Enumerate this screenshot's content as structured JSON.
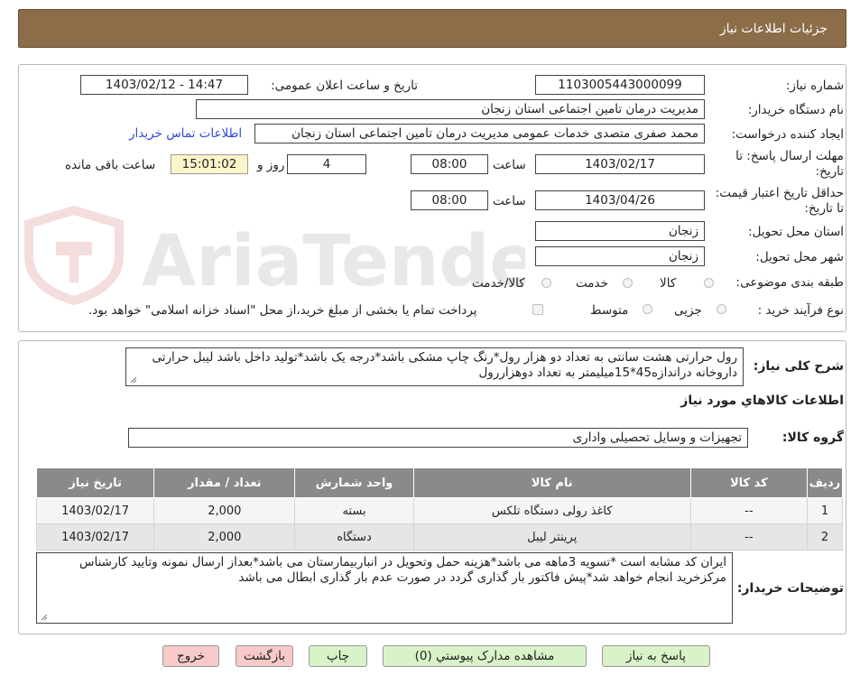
{
  "header": {
    "title": "جزئیات اطلاعات نیاز"
  },
  "labels": {
    "need_number": "شماره نیاز:",
    "announce_datetime": "تاریخ و ساعت اعلان عمومی:",
    "buyer_org": "نام دستگاه خریدار:",
    "requester": "ایجاد کننده درخواست:",
    "reply_deadline": "مهلت ارسال پاسخ: تا تاریخ:",
    "time": "ساعت",
    "day_and": "روز و",
    "remaining": "ساعت باقی مانده",
    "price_validity": "حداقل تاریخ اعتبار قیمت: تا تاریخ:",
    "delivery_province": "استان محل تحویل:",
    "delivery_city": "شهر محل تحویل:",
    "category": "طبقه بندی موضوعی:",
    "process_type": "نوع فرآیند خرید :",
    "general_desc": "شرح کلی نیاز:",
    "items_info": "اطلاعات کالاهاي مورد نياز",
    "goods_group": "گروه کالا:",
    "buyer_notes": "توضیحات خریدار:"
  },
  "values": {
    "need_number": "1103005443000099",
    "announce_datetime": "1403/02/12 - 14:47",
    "buyer_org": "مدیریت درمان تامین اجتماعی استان زنجان",
    "requester": "محمد صفری متصدی خدمات عمومی مدیریت درمان تامین اجتماعی استان زنجان",
    "contact_link": "اطلاعات تماس خریدار",
    "reply_date": "1403/02/17",
    "reply_time": "08:00",
    "days": "4",
    "remaining_time": "15:01:02",
    "validity_date": "1403/04/26",
    "validity_time": "08:00",
    "province": "زنجان",
    "city": "زنجان",
    "goods_group": "تجهیزات و وسایل تحصیلی واداری",
    "general_desc": "رول حرارتی هشت سانتی به تعداد دو هزار رول*رنگ چاپ مشکی باشد*درجه یک باشد*تولید داخل باشد لیبل حرارتی داروخانه دراندازه45*15میلیمتر به تعداد دوهزاررول",
    "buyer_notes": "ایران کد مشابه است *تسویه 3ماهه می باشد*هزینه حمل وتحویل در انباربیمارستان می باشد*بعداز ارسال نمونه وتایید کارشناس مرکزخرید انجام خواهد شد*پیش فاکتور بار گذاری گردد در صورت عدم بار گذاری ابطال می باشد"
  },
  "category_options": {
    "goods": "کالا",
    "service": "خدمت",
    "goods_service": "کالا/خدمت"
  },
  "process_options": {
    "partial": "جزیی",
    "medium": "متوسط",
    "treasury_note": "پرداخت تمام یا بخشی از مبلغ خرید،از محل \"اسناد خزانه اسلامی\" خواهد بود."
  },
  "table": {
    "headers": [
      "ردیف",
      "کد کالا",
      "نام کالا",
      "واحد شمارش",
      "تعداد / مقدار",
      "تاریخ نیاز"
    ],
    "rows": [
      [
        "1",
        "--",
        "کاغذ رولی دستگاه تلکس",
        "بسته",
        "2,000",
        "1403/02/17"
      ],
      [
        "2",
        "--",
        "پرینتر لیبل",
        "دستگاه",
        "2,000",
        "1403/02/17"
      ]
    ]
  },
  "buttons": {
    "reply": "پاسخ به نیاز",
    "attachments": "مشاهده مدارک پیوستي (0)",
    "print": "چاپ",
    "back": "بازگشت",
    "exit": "خروج"
  },
  "watermark": {
    "text": "AriaTender.neT"
  },
  "colors": {
    "header_bg": "#8c6d49",
    "table_header": "#8a8a8a",
    "link": "#2d4bd0",
    "button_green": "#d8f3c8",
    "button_pink": "#f7c9c9"
  }
}
